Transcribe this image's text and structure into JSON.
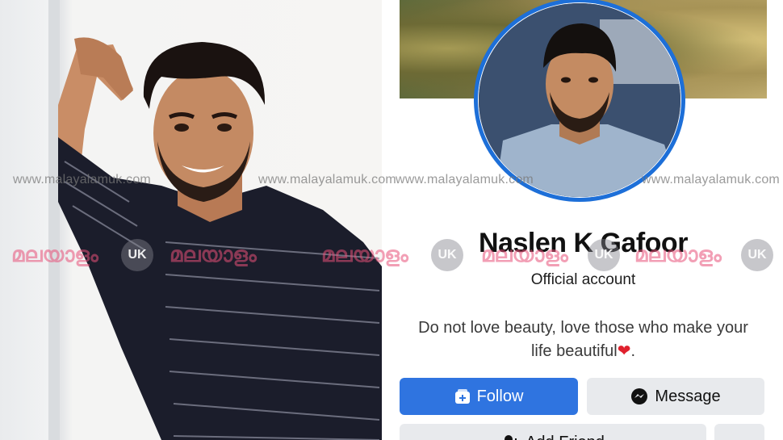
{
  "profile": {
    "name": "Naslen K Gafoor",
    "subtitle": "Official account",
    "bio_line1": "Do not love beauty, love those who make your",
    "bio_line2": "life beautiful",
    "bio_emoji": "❤",
    "follow_label": "Follow",
    "message_label": "Message",
    "add_friend_label": "Add Friend"
  },
  "watermark": {
    "url": "www.malayalamuk.com",
    "logo_text": "മലയാളം",
    "badge": "UK"
  },
  "icons": [
    "follow-plus-icon",
    "messenger-icon",
    "add-friend-icon",
    "more-icon"
  ],
  "colors": {
    "follow_button": "#2f74e0",
    "secondary_button": "#e8eaed",
    "avatar_ring": "#1d6fd8",
    "watermark_logo": "#e85078"
  }
}
